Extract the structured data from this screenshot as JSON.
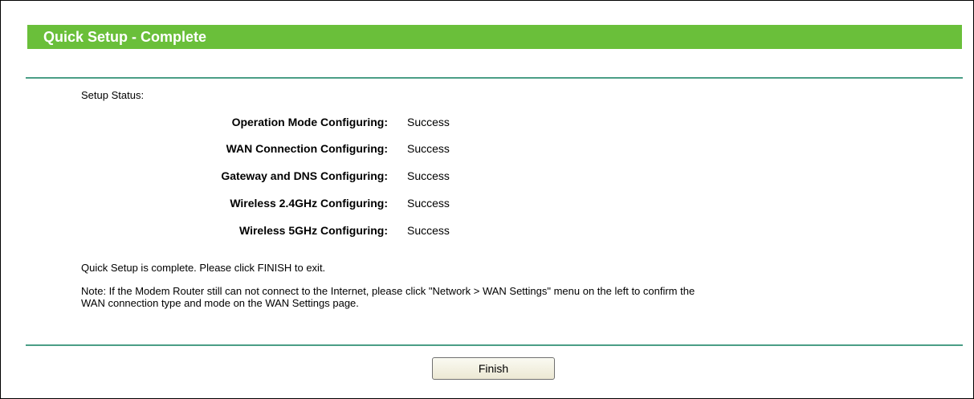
{
  "header": {
    "title": "Quick Setup - Complete"
  },
  "setup_status": {
    "label": "Setup Status:",
    "items": [
      {
        "label": "Operation Mode Configuring:",
        "value": "Success"
      },
      {
        "label": "WAN Connection Configuring:",
        "value": "Success"
      },
      {
        "label": "Gateway and DNS Configuring:",
        "value": "Success"
      },
      {
        "label": "Wireless 2.4GHz Configuring:",
        "value": "Success"
      },
      {
        "label": "Wireless 5GHz Configuring:",
        "value": "Success"
      }
    ]
  },
  "messages": {
    "complete": "Quick Setup is complete. Please click FINISH to exit.",
    "note_line1": "Note: If the Modem Router still can not connect to the Internet, please click \"Network > WAN Settings\" menu on the left to confirm the",
    "note_line2": "WAN connection type and mode on the WAN Settings page."
  },
  "actions": {
    "finish_label": "Finish"
  },
  "colors": {
    "title_bar": "#6abf3a",
    "divider": "#4a9e86"
  }
}
